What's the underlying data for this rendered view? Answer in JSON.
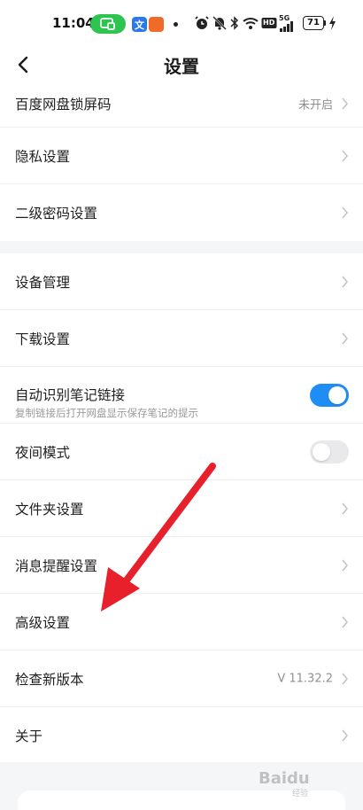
{
  "status_bar": {
    "time": "11:04",
    "app_badge_1": "文",
    "battery": "71",
    "network": "5G",
    "hd": "HD"
  },
  "header": {
    "title": "设置"
  },
  "group1": [
    {
      "label": "百度网盘锁屏码",
      "value": "未开启"
    },
    {
      "label": "隐私设置"
    },
    {
      "label": "二级密码设置"
    }
  ],
  "group2": [
    {
      "label": "设备管理"
    },
    {
      "label": "下载设置"
    },
    {
      "label": "自动识别笔记链接",
      "sub": "复制链接后打开网盘显示保存笔记的提示",
      "toggle": true
    },
    {
      "label": "夜间模式",
      "toggle": false
    },
    {
      "label": "文件夹设置"
    },
    {
      "label": "消息提醒设置"
    },
    {
      "label": "高级设置"
    },
    {
      "label": "检查新版本",
      "value": "V 11.32.2"
    },
    {
      "label": "关于"
    }
  ],
  "colors": {
    "accent": "#1e8ef5",
    "annotation_arrow": "#e8202c",
    "cast_green": "#2dc44f"
  },
  "watermark": "Baidu",
  "watermark_sub": "经验"
}
